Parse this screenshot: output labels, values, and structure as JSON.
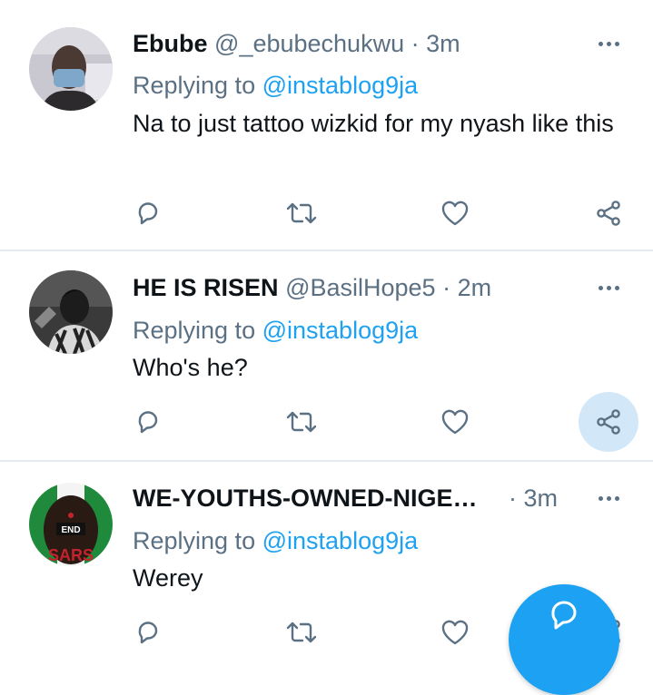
{
  "colors": {
    "accent": "#1da1f2",
    "muted": "#5b7083",
    "divider": "#e6ecf0",
    "text": "#0f1419"
  },
  "tweets": [
    {
      "name": "Ebube",
      "handle": "@_ebubechukwu",
      "dot": "·",
      "time": "3m",
      "replying_prefix": "Replying to",
      "replying_to": "@instablog9ja",
      "text": "Na to just tattoo wizkid for my nyash like this"
    },
    {
      "name": "HE IS RISEN",
      "handle": "@BasilHope5",
      "dot": "·",
      "time": "2m",
      "replying_prefix": "Replying to",
      "replying_to": "@instablog9ja",
      "text": "Who's he?"
    },
    {
      "name": "WE-YOUTHS-OWNED-NIGERIA",
      "handle": "",
      "dot": "·",
      "time": "3m",
      "replying_prefix": "Replying to",
      "replying_to": "@instablog9ja",
      "text": "Werey"
    }
  ],
  "avatar3_text": {
    "top": "END",
    "bottom": "SARS"
  },
  "icons": {
    "more": "more-horizontal-icon",
    "reply": "reply-bubble-icon",
    "retweet": "retweet-icon",
    "like": "heart-icon",
    "share": "share-icon",
    "compose": "compose-bubble-icon"
  }
}
